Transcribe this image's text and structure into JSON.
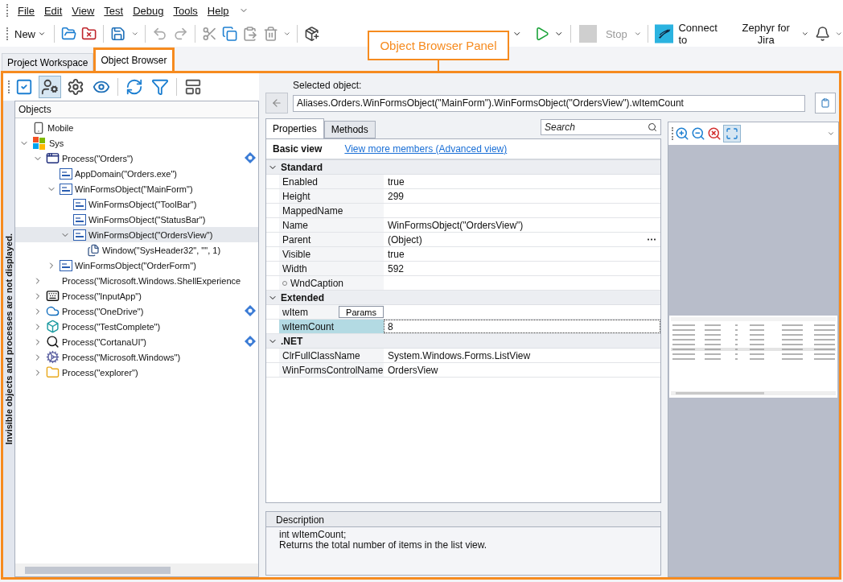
{
  "menu": [
    "File",
    "Edit",
    "View",
    "Test",
    "Debug",
    "Tools",
    "Help"
  ],
  "toolbar": {
    "new_button": "New",
    "stop_button": {
      "label": "Stop",
      "disabled": true
    },
    "connect_label": "Connect to",
    "integration_dropdown": "Zephyr for Jira"
  },
  "tabs": [
    {
      "label": "Project Workspace",
      "selected": false
    },
    {
      "label": "Object Browser",
      "selected": true
    }
  ],
  "callout": {
    "label": "Object Browser Panel"
  },
  "side_note": "Invisible objects and processes are not displayed.",
  "tree": {
    "header": "Objects",
    "items": [
      {
        "label": "Mobile",
        "kind": "mobile",
        "expandable": false,
        "selected": false,
        "mapped": false
      },
      {
        "label": "Sys",
        "kind": "system",
        "expandable": true,
        "expanded": true,
        "selected": false,
        "mapped": false,
        "children": [
          {
            "label": "Process(\"Orders\")",
            "kind": "window",
            "expandable": true,
            "expanded": true,
            "selected": false,
            "mapped": true,
            "children": [
              {
                "label": "AppDomain(\"Orders.exe\")",
                "kind": "net",
                "expandable": false,
                "selected": false,
                "mapped": false
              },
              {
                "label": "WinFormsObject(\"MainForm\")",
                "kind": "net",
                "expandable": true,
                "expanded": true,
                "selected": false,
                "mapped": false,
                "children": [
                  {
                    "label": "WinFormsObject(\"ToolBar\")",
                    "kind": "net",
                    "expandable": false,
                    "selected": false,
                    "mapped": false
                  },
                  {
                    "label": "WinFormsObject(\"StatusBar\")",
                    "kind": "net",
                    "expandable": false,
                    "selected": false,
                    "mapped": false
                  },
                  {
                    "label": "WinFormsObject(\"OrdersView\")",
                    "kind": "net",
                    "expandable": true,
                    "expanded": true,
                    "selected": true,
                    "mapped": false,
                    "children": [
                      {
                        "label": "Window(\"SysHeader32\", \"\", 1)",
                        "kind": "subwindow",
                        "expandable": false,
                        "selected": false,
                        "mapped": false
                      }
                    ]
                  }
                ]
              },
              {
                "label": "WinFormsObject(\"OrderForm\")",
                "kind": "net",
                "expandable": true,
                "expanded": false,
                "selected": false,
                "mapped": false
              }
            ]
          },
          {
            "label": "Process(\"Microsoft.Windows.ShellExperience",
            "kind": "none",
            "expandable": true,
            "expanded": false,
            "selected": false,
            "mapped": false
          },
          {
            "label": "Process(\"InputApp\")",
            "kind": "keyboard",
            "expandable": true,
            "expanded": false,
            "selected": false,
            "mapped": false
          },
          {
            "label": "Process(\"OneDrive\")",
            "kind": "cloud",
            "expandable": true,
            "expanded": false,
            "selected": false,
            "mapped": true
          },
          {
            "label": "Process(\"TestComplete\")",
            "kind": "app",
            "expandable": true,
            "expanded": false,
            "selected": false,
            "mapped": false
          },
          {
            "label": "Process(\"CortanaUI\")",
            "kind": "search",
            "expandable": true,
            "expanded": false,
            "selected": false,
            "mapped": true
          },
          {
            "label": "Process(\"Microsoft.Windows\")",
            "kind": "gear",
            "expandable": true,
            "expanded": false,
            "selected": false,
            "mapped": false
          },
          {
            "label": "Process(\"explorer\")",
            "kind": "folder",
            "expandable": true,
            "expanded": false,
            "selected": false,
            "mapped": false
          }
        ]
      }
    ]
  },
  "selected_object": {
    "label": "Selected object:",
    "path": "Aliases.Orders.WinFormsObject(\"MainForm\").WinFormsObject(\"OrdersView\").wItemCount"
  },
  "inspector_tabs": [
    {
      "label": "Properties",
      "selected": true
    },
    {
      "label": "Methods",
      "selected": false
    }
  ],
  "search": {
    "placeholder": "Search"
  },
  "view_label": "Basic view",
  "view_link": "View more members (Advanced view)",
  "groups": [
    {
      "name": "Standard",
      "expanded": true,
      "rows": [
        {
          "name": "Enabled",
          "value": "true",
          "kind": "plain",
          "selected": false
        },
        {
          "name": "Height",
          "value": "299",
          "kind": "plain",
          "selected": false
        },
        {
          "name": "MappedName",
          "kind": "plain",
          "selected": false
        },
        {
          "name": "Name",
          "value": "WinFormsObject(\"OrdersView\")",
          "kind": "plain",
          "selected": false
        },
        {
          "name": "Parent",
          "value": "(Object)",
          "kind": "object",
          "selected": false
        },
        {
          "name": "Visible",
          "value": "true",
          "kind": "plain",
          "selected": false
        },
        {
          "name": "Width",
          "value": "592",
          "kind": "plain",
          "selected": false
        },
        {
          "name": "WndCaption",
          "kind": "marked",
          "selected": false
        }
      ]
    },
    {
      "name": "Extended",
      "expanded": true,
      "rows": [
        {
          "name": "wItem",
          "kind": "params",
          "button": "Params",
          "selected": false
        },
        {
          "name": "wItemCount",
          "value": "8",
          "kind": "plain",
          "selected": true
        }
      ]
    },
    {
      "name": ".NET",
      "expanded": true,
      "rows": [
        {
          "name": "ClrFullClassName",
          "value": "System.Windows.Forms.ListView",
          "kind": "plain",
          "selected": false
        },
        {
          "name": "WinFormsControlName",
          "value": "OrdersView",
          "kind": "plain",
          "selected": false
        }
      ]
    }
  ],
  "description": {
    "title": "Description",
    "lines": [
      "int wItemCount;",
      "Returns the total number of items in the list view."
    ]
  },
  "preview": {
    "kind": "picture"
  }
}
